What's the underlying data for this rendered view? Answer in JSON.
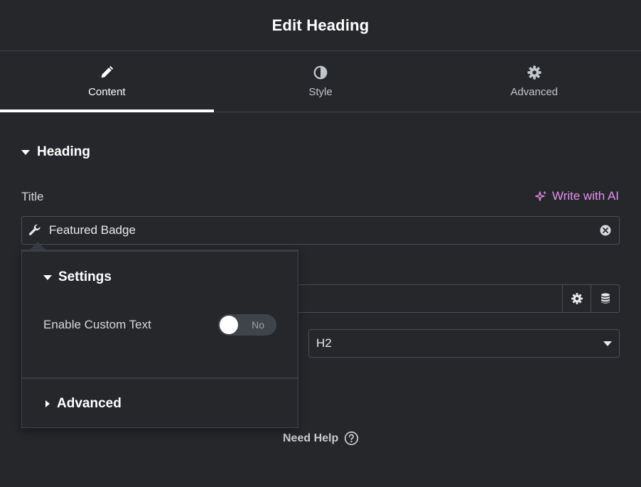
{
  "header": {
    "title": "Edit Heading"
  },
  "tabs": [
    {
      "label": "Content",
      "icon": "pencil-icon",
      "active": true
    },
    {
      "label": "Style",
      "icon": "contrast-icon",
      "active": false
    },
    {
      "label": "Advanced",
      "icon": "gear-icon",
      "active": false
    }
  ],
  "section": {
    "title": "Heading"
  },
  "title_field": {
    "label": "Title",
    "ai_link": "Write with AI",
    "value": "Featured Badge"
  },
  "html_tag": {
    "value": "H2"
  },
  "popover": {
    "settings_title": "Settings",
    "custom_text_label": "Enable Custom Text",
    "toggle_text": "No",
    "advanced_title": "Advanced"
  },
  "help": {
    "label": "Need Help"
  },
  "colors": {
    "background": "#26272b",
    "accent_ai": "#e88ff2",
    "border": "#4a4e55"
  }
}
